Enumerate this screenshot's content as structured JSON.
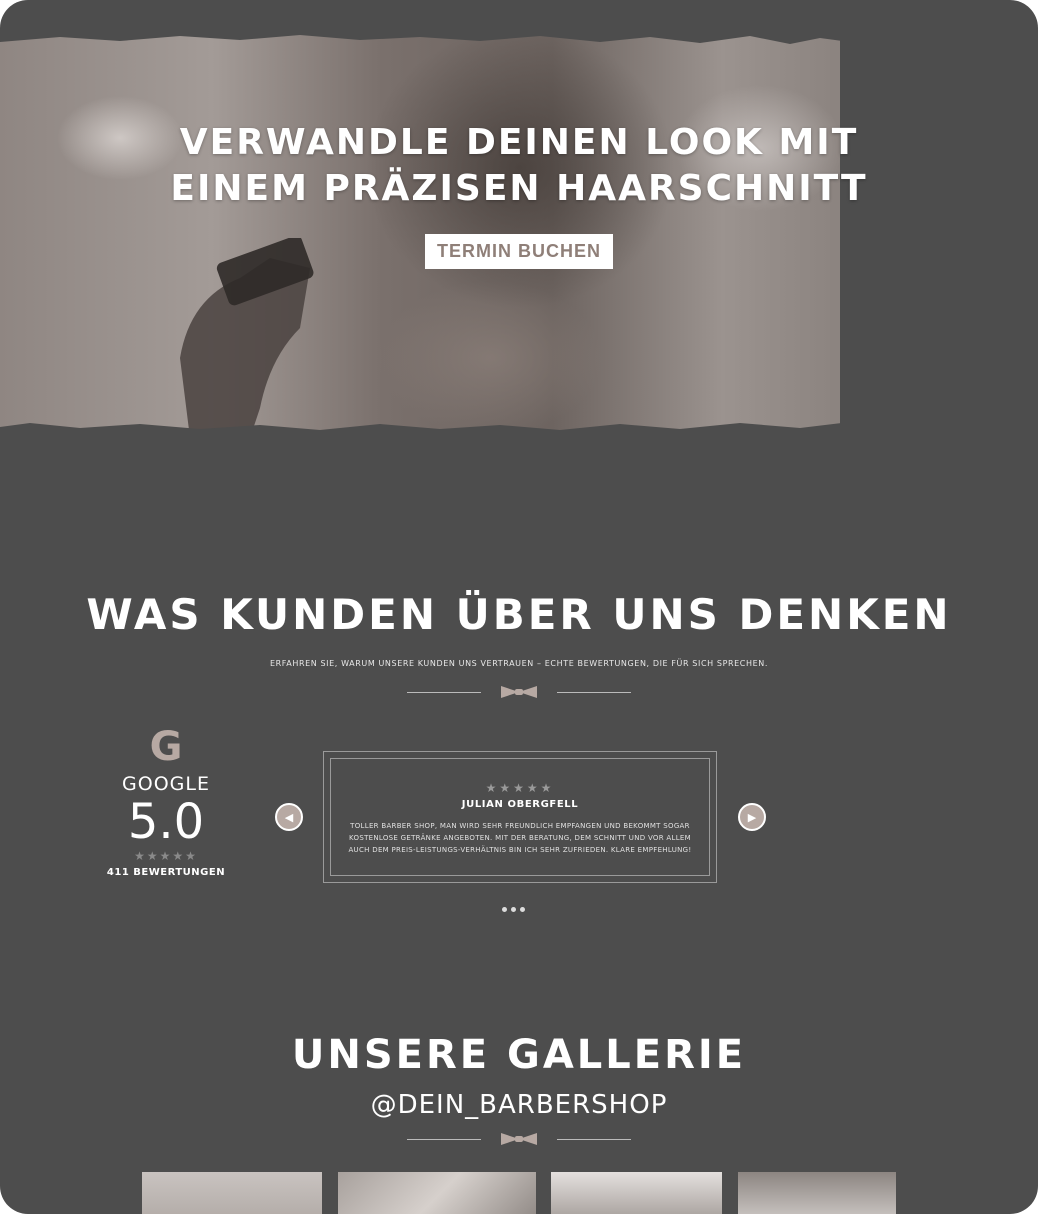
{
  "hero": {
    "title_line1": "VERWANDLE DEINEN LOOK MIT",
    "title_line2": "EINEM PRÄZISEN HAARSCHNITT",
    "button": "TERMIN BUCHEN"
  },
  "reviews": {
    "title": "WAS KUNDEN ÜBER UNS DENKEN",
    "subtitle": "ERFAHREN SIE, WARUM UNSERE KUNDEN UNS VERTRAUEN – ECHTE BEWERTUNGEN, DIE FÜR SICH SPRECHEN.",
    "google": {
      "logo": "G",
      "name": "GOOGLE",
      "score": "5.0",
      "stars": "★★★★★",
      "count": "411 BEWERTUNGEN"
    },
    "card": {
      "stars": "★★★★★",
      "name": "JULIAN OBERGFELL",
      "text": "TOLLER BARBER SHOP, MAN WIRD SEHR FREUNDLICH EMPFANGEN UND BEKOMMT SOGAR KOSTENLOSE GETRÄNKE ANGEBOTEN. MIT DER BERATUNG, DEM SCHNITT UND VOR ALLEM AUCH DEM PREIS-LEISTUNGS-VERHÄLTNIS BIN ICH SEHR ZUFRIEDEN. KLARE EMPFEHLUNG!"
    },
    "arrow_left": "◀",
    "arrow_right": "▶",
    "dots_count": 3
  },
  "gallery": {
    "title": "UNSERE GALLERIE",
    "handle": "@DEIN_BARBERSHOP"
  },
  "colors": {
    "background": "#4d4d4d",
    "accent": "#b7a9a3",
    "button_text": "#8f7f78"
  }
}
